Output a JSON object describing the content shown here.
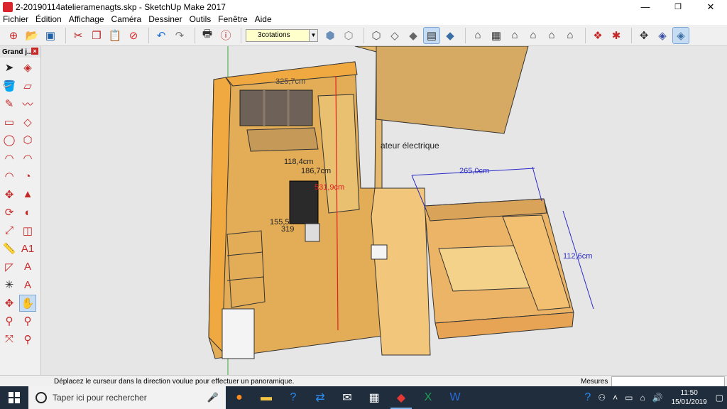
{
  "window": {
    "title": "2-20190114atelieramenagts.skp - SketchUp Make 2017"
  },
  "menu": [
    "Fichier",
    "Édition",
    "Affichage",
    "Caméra",
    "Dessiner",
    "Outils",
    "Fenêtre",
    "Aide"
  ],
  "toolbar": {
    "scene_value": "3cotations",
    "buttons": [
      "new-file-icon",
      "open-folder-icon",
      "save-icon",
      "cut-icon",
      "copy-icon",
      "paste-icon",
      "erase-icon",
      "undo-icon",
      "redo-icon",
      "print-icon",
      "model-info-icon"
    ],
    "style_buttons": [
      "xray-style-icon",
      "back-edges-style-icon",
      "wireframe-style-icon",
      "hidden-line-style-icon",
      "shaded-style-icon",
      "shaded-textures-style-icon",
      "monochrome-style-icon"
    ],
    "view_buttons": [
      "iso-view-icon",
      "top-view-icon",
      "front-view-icon",
      "right-view-icon",
      "back-view-icon",
      "left-view-icon"
    ],
    "extra_buttons": [
      "warehouse-icon",
      "extension-warehouse-icon",
      "orbit-icon",
      "section-icon",
      "perspective-icon"
    ]
  },
  "tool_panel": {
    "title": "Grand j...",
    "tools": [
      "select-icon",
      "make-component-icon",
      "paint-bucket-icon",
      "eraser-icon",
      "pencil-icon",
      "freehand-icon",
      "rectangle-icon",
      "rotated-rectangle-icon",
      "circle-icon",
      "polygon-icon",
      "arc-icon",
      "arc-2pt-icon",
      "arc-3pt-icon",
      "pie-icon",
      "move-icon",
      "push-pull-icon",
      "rotate-icon",
      "follow-me-icon",
      "scale-icon",
      "offset-icon",
      "tape-measure-icon",
      "dimension-icon",
      "protractor-icon",
      "text-icon",
      "axes-icon",
      "3d-text-icon",
      "orbit-tool-icon",
      "pan-tool-icon",
      "zoom-icon",
      "zoom-window-icon",
      "zoom-extents-icon",
      "previous-view-icon"
    ]
  },
  "model": {
    "label_heater": "ateur électrique",
    "dims": [
      "325,7cm",
      "118,4cm",
      "186,7cm",
      "531,9cm",
      "155,5",
      "319",
      "265,0cm",
      "112,6cm"
    ]
  },
  "status": {
    "hint": "Déplacez le curseur dans la direction voulue pour effectuer un panoramique.",
    "measure_label": "Mesures",
    "measure_value": ""
  },
  "taskbar": {
    "search_placeholder": "Taper ici pour rechercher",
    "time": "11:50",
    "date": "15/01/2019"
  }
}
